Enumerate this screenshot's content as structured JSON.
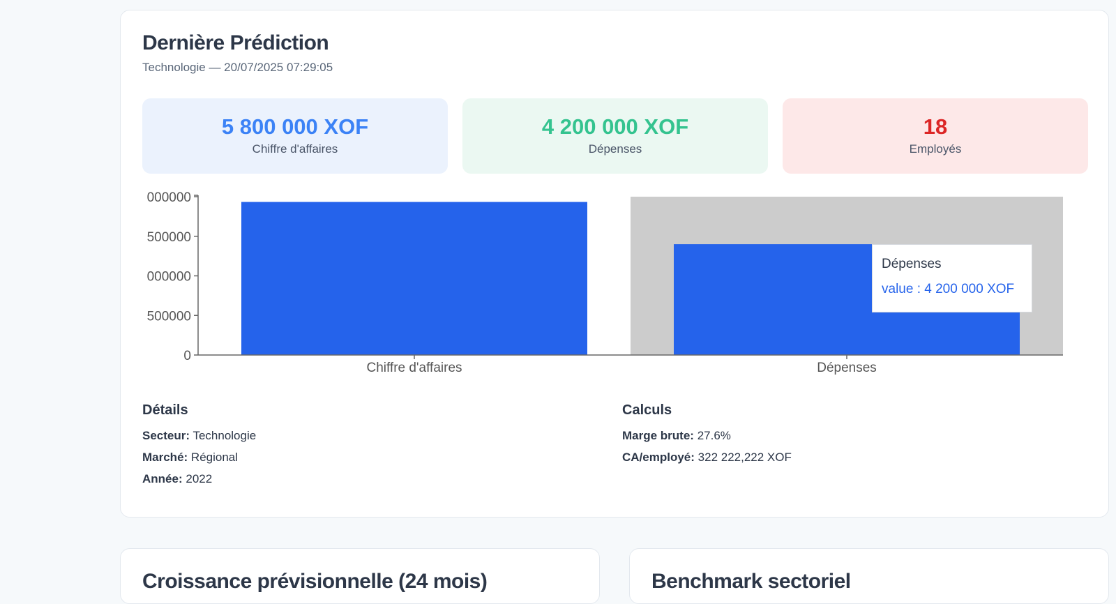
{
  "prediction": {
    "title": "Dernière Prédiction",
    "subtitle": "Technologie — 20/07/2025 07:29:05",
    "stats": {
      "revenue": {
        "value": "5 800 000 XOF",
        "label": "Chiffre d'affaires",
        "color": "#3b82f6"
      },
      "expenses": {
        "value": "4 200 000 XOF",
        "label": "Dépenses",
        "color": "#34c38f"
      },
      "employees": {
        "value": "18",
        "label": "Employés",
        "color": "#dc2626"
      }
    },
    "tooltip": {
      "title": "Dépenses",
      "value": "value : 4 200 000 XOF"
    },
    "details": {
      "heading": "Détails",
      "sector_label": "Secteur:",
      "sector_value": "Technologie",
      "market_label": "Marché:",
      "market_value": "Régional",
      "year_label": "Année:",
      "year_value": "2022"
    },
    "calculs": {
      "heading": "Calculs",
      "margin_label": "Marge brute:",
      "margin_value": "27.6%",
      "ca_emp_label": "CA/employé:",
      "ca_emp_value": "322 222,222 XOF"
    }
  },
  "chart_data": {
    "type": "bar",
    "categories": [
      "Chiffre d'affaires",
      "Dépenses"
    ],
    "values": [
      5800000,
      4200000
    ],
    "yticks": [
      0,
      1500000,
      3000000,
      4500000,
      6000000
    ],
    "ytick_labels": [
      "0",
      "500000",
      "000000",
      "500000",
      "000000"
    ],
    "ylim": [
      0,
      6000000
    ],
    "bar_color": "#2563eb",
    "hover_color": "#cccccc",
    "hover_index": 1
  },
  "lower_cards": {
    "growth_title": "Croissance prévisionnelle (24 mois)",
    "benchmark_title": "Benchmark sectoriel"
  }
}
